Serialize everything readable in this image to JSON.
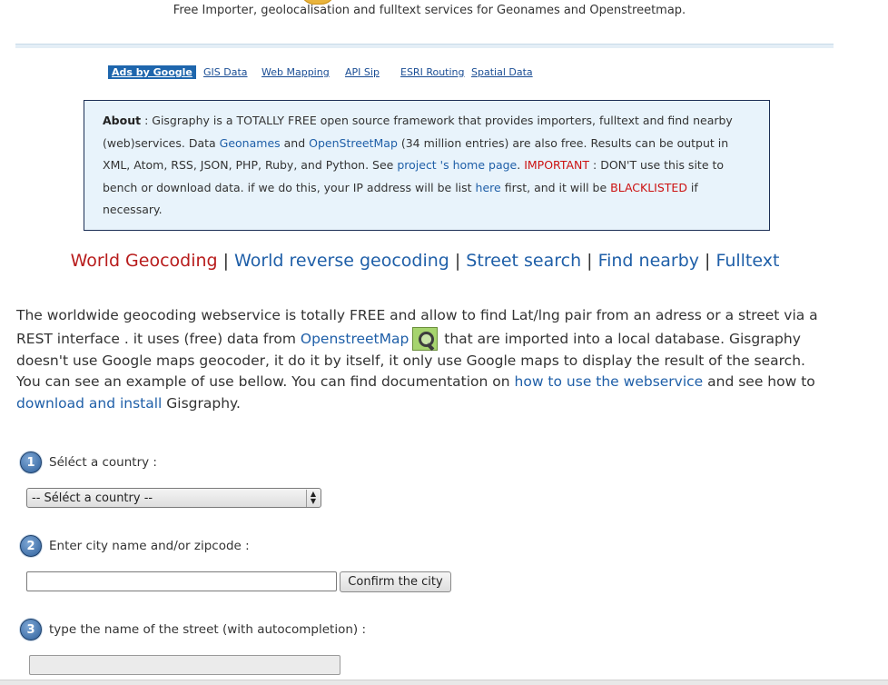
{
  "header": {
    "tagline": "Free Importer, geolocalisation and fulltext services for Geonames and Openstreetmap."
  },
  "ads": {
    "label": "Ads by Google",
    "links": [
      "GIS Data",
      "Web Mapping",
      "API Sip",
      "ESRI Routing",
      "Spatial Data"
    ]
  },
  "about": {
    "label": "About",
    "t1": " : Gisgraphy is a TOTALLY FREE open source framework that provides importers, fulltext and find nearby (web)services. Data ",
    "geonames": "Geonames",
    "and": " and ",
    "osm": "OpenStreetMap",
    "t2": " (34 million entries) are also free. Results can be output in XML, Atom, RSS, JSON, PHP, Ruby, and Python. See ",
    "project": "project 's home page",
    "dot": ". ",
    "important": "IMPORTANT",
    "t3": " : DON'T use this site to bench or download data. if we do this, your IP address will be list ",
    "here": "here",
    "t4": " first, and it will be ",
    "blacklisted": "BLACKLISTED",
    "t5": " if necessary."
  },
  "nav": {
    "items": [
      "World Geocoding",
      "World reverse geocoding",
      "Street search",
      "Find nearby",
      "Fulltext"
    ],
    "separator": "|"
  },
  "intro": {
    "t1": "The worldwide geocoding webservice is totally FREE and allow to find Lat/lng pair from an adress or a street via a REST interface . it uses (free) data from ",
    "osm_link": "OpenstreetMap",
    "t2": " that are imported into a local database. Gisgraphy doesn't use Google maps geocoder, it do it by itself, it only use Google maps to display the result of the search. You can see an example of use bellow. You can find documentation on ",
    "doc_link": "how to use the webservice",
    "t3": " and see how to ",
    "install_link": "download and install",
    "t4": " Gisgraphy."
  },
  "form": {
    "step1": {
      "number": "1",
      "label": "Séléct a country :",
      "select_value": "-- Séléct a country --"
    },
    "step2": {
      "number": "2",
      "label": "Enter city name and/or zipcode :",
      "input_value": "",
      "button": "Confirm the city"
    },
    "step3": {
      "number": "3",
      "label": "type the name of the street (with autocompletion) :",
      "input_value": ""
    }
  },
  "icons": {
    "osm": "openstreetmap-magnifier-icon",
    "select_arrows": "select-updown-icon"
  },
  "colors": {
    "link": "#1f5fa8",
    "active_nav": "#b81c1c",
    "warning": "#cc1111",
    "about_bg": "#e8f3fb",
    "ads_label_bg": "#1e66ad"
  }
}
